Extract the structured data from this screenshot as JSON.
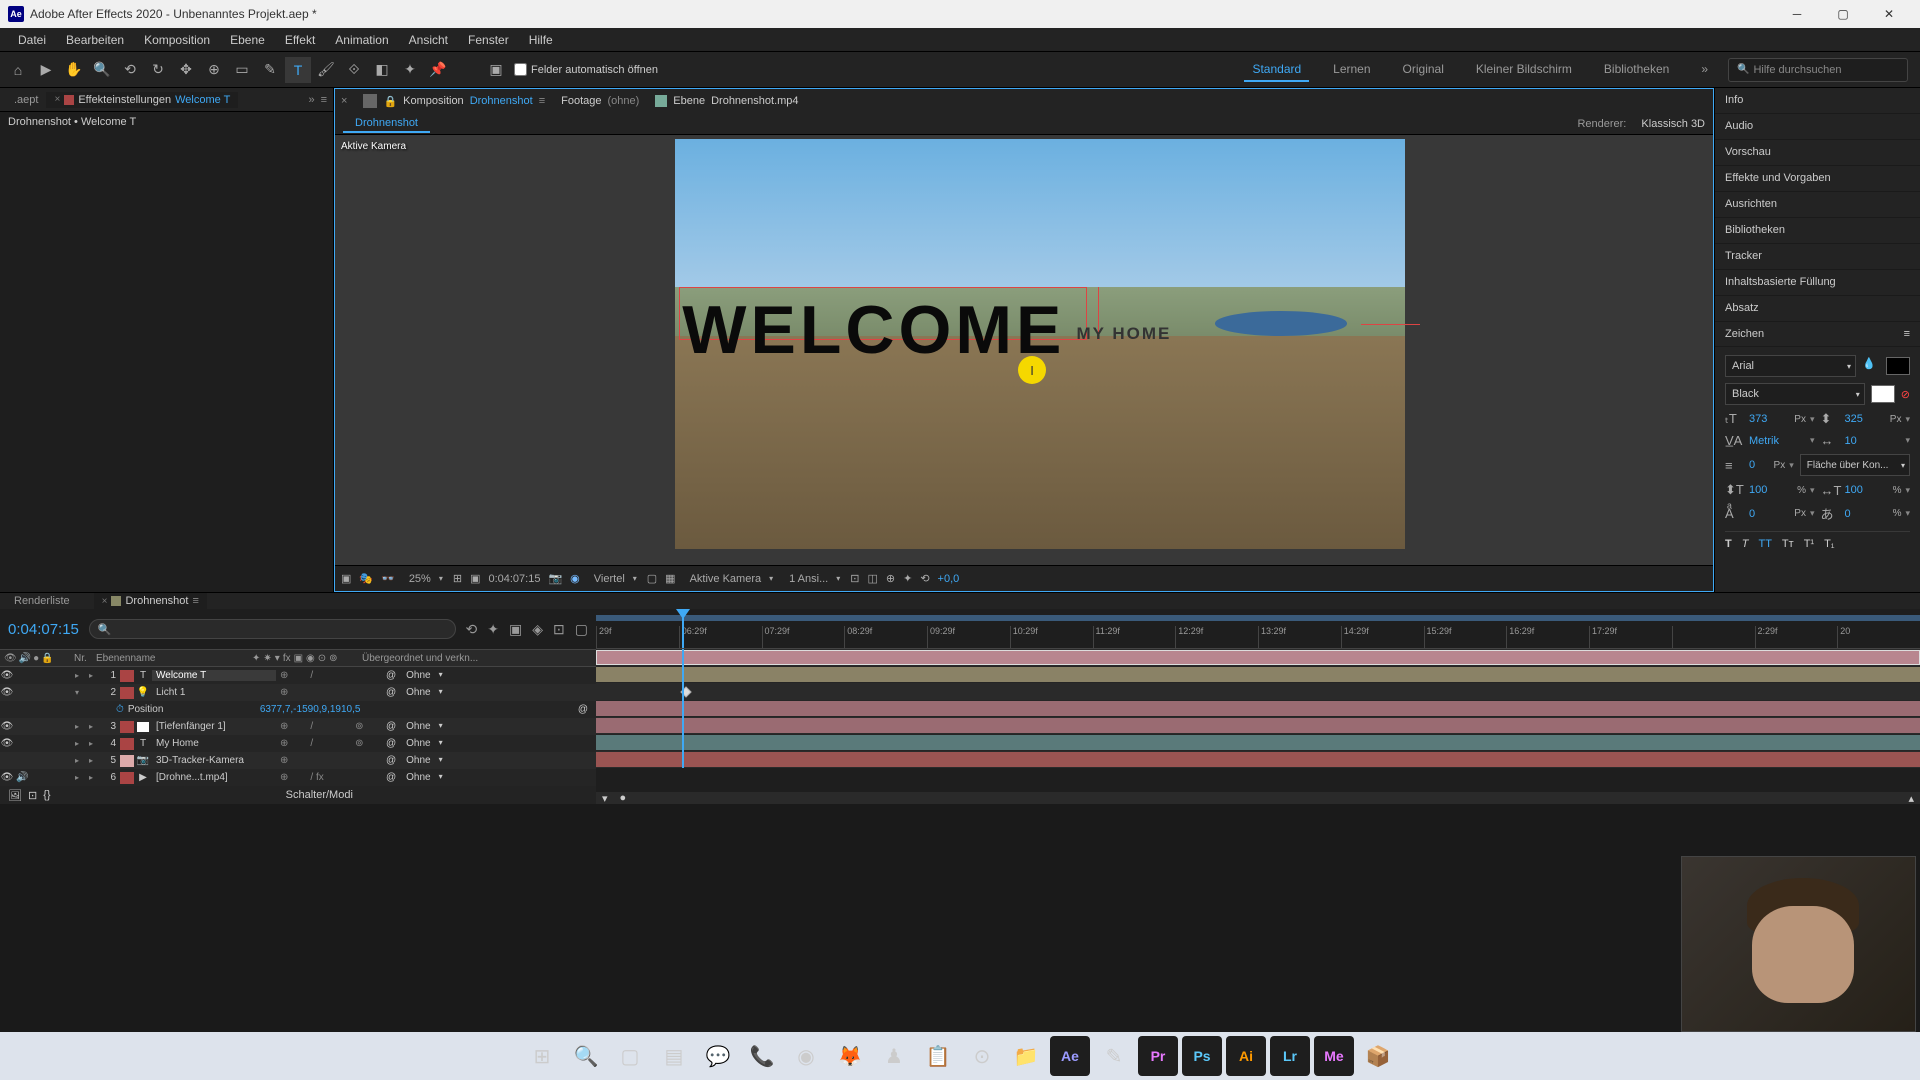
{
  "window": {
    "app_name": "Ae",
    "title": "Adobe After Effects 2020 - Unbenanntes Projekt.aep *"
  },
  "menu": [
    "Datei",
    "Bearbeiten",
    "Komposition",
    "Ebene",
    "Effekt",
    "Animation",
    "Ansicht",
    "Fenster",
    "Hilfe"
  ],
  "toolbar": {
    "snap_label": "Felder automatisch öffnen"
  },
  "workspaces": [
    "Standard",
    "Lernen",
    "Original",
    "Kleiner Bildschirm",
    "Bibliotheken"
  ],
  "search": {
    "placeholder": "Hilfe durchsuchen"
  },
  "left_panel": {
    "tab1": ".aept",
    "tab2_label": "Effekteinstellungen",
    "tab2_name": "Welcome T",
    "breadcrumb": "Drohnenshot • Welcome T"
  },
  "center": {
    "comp_label": "Komposition",
    "comp_name": "Drohnenshot",
    "footage_label": "Footage",
    "footage_val": "(ohne)",
    "layer_label": "Ebene",
    "layer_name": "Drohnenshot.mp4",
    "crumb": "Drohnenshot",
    "renderer_label": "Renderer:",
    "renderer_val": "Klassisch 3D",
    "active_camera": "Aktive Kamera",
    "text1": "WELCOME",
    "text2": "MY HOME"
  },
  "viewport_footer": {
    "zoom": "25%",
    "timecode": "0:04:07:15",
    "res": "Viertel",
    "view": "Aktive Kamera",
    "views": "1 Ansi...",
    "exposure": "+0,0"
  },
  "right_panel": {
    "sections": [
      "Info",
      "Audio",
      "Vorschau",
      "Effekte und Vorgaben",
      "Ausrichten",
      "Bibliotheken",
      "Tracker",
      "Inhaltsbasierte Füllung",
      "Absatz"
    ],
    "char_title": "Zeichen",
    "font": "Arial",
    "weight": "Black",
    "size": "373",
    "leading": "325",
    "px": "Px",
    "kerning": "Metrik",
    "tracking": "10",
    "stroke": "0",
    "stroke_opt": "Fläche über Kon...",
    "hscale": "100",
    "vscale": "100",
    "pct": "%",
    "baseline": "0",
    "tsume": "0"
  },
  "timeline": {
    "render_tab": "Renderliste",
    "comp_tab": "Drohnenshot",
    "timecode": "0:04:07:15",
    "col_nr": "Nr.",
    "col_name": "Ebenenname",
    "col_parent": "Übergeordnet und verkn...",
    "none": "Ohne",
    "footer": "Schalter/Modi",
    "ticks": [
      "29f",
      "06:29f",
      "07:29f",
      "08:29f",
      "09:29f",
      "10:29f",
      "11:29f",
      "12:29f",
      "13:29f",
      "14:29f",
      "15:29f",
      "16:29f",
      "17:29f",
      "",
      "2:29f",
      "20"
    ],
    "position_label": "Position",
    "position_val": "6377,7,-1590,9,1910,5",
    "layers": [
      {
        "num": "1",
        "color": "#b85",
        "icon": "T",
        "name": "Welcome T",
        "selected": true,
        "threed": false
      },
      {
        "num": "2",
        "color": "#b85",
        "icon": "💡",
        "name": "Licht 1",
        "selected": false,
        "threed": false
      },
      {
        "num": "3",
        "color": "#b85",
        "icon": "□",
        "name": "[Tiefenfänger 1]",
        "selected": false,
        "threed": true
      },
      {
        "num": "4",
        "color": "#b85",
        "icon": "T",
        "name": "My Home",
        "selected": false,
        "threed": true
      },
      {
        "num": "5",
        "color": "#daa",
        "icon": "📷",
        "name": "3D-Tracker-Kamera",
        "selected": false,
        "threed": false
      },
      {
        "num": "6",
        "color": "#b85",
        "icon": "▶",
        "name": "[Drohne...t.mp4]",
        "selected": false,
        "threed": false
      }
    ]
  },
  "taskbar": {
    "icons": [
      "⊞",
      "🔍",
      "▢",
      "▤",
      "💬",
      "📞",
      "◉",
      "🦊",
      "♟",
      "📋",
      "⊙",
      "📁"
    ],
    "adobe": [
      "Ae",
      "✎",
      "Pr",
      "Ps",
      "Ai",
      "Lr",
      "Me"
    ],
    "last": "📦"
  }
}
